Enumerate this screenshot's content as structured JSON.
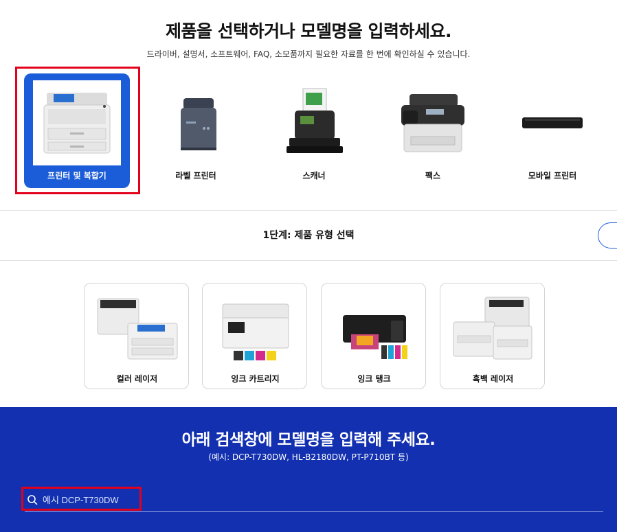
{
  "header": {
    "title": "제품을 선택하거나 모델명을 입력하세요.",
    "subtitle": "드라이버, 설명서, 소프트웨어, FAQ, 소모품까지 필요한 자료를 한 번에 확인하실 수 있습니다."
  },
  "categories": [
    {
      "label": "프린터 및 복합기",
      "icon": "laser-printer-image",
      "selected": true
    },
    {
      "label": "라벨 프린터",
      "icon": "label-printer-image",
      "selected": false
    },
    {
      "label": "스캐너",
      "icon": "scanner-image",
      "selected": false
    },
    {
      "label": "팩스",
      "icon": "fax-image",
      "selected": false
    },
    {
      "label": "모바일 프린터",
      "icon": "mobile-printer-image",
      "selected": false
    }
  ],
  "step": {
    "title": "1단계: 제품 유형 선택"
  },
  "types": [
    {
      "label": "컬러 레이저",
      "icon": "color-laser-image"
    },
    {
      "label": "잉크 카트리지",
      "icon": "ink-cartridge-printer-image"
    },
    {
      "label": "잉크 탱크",
      "icon": "ink-tank-printer-image"
    },
    {
      "label": "흑백 레이저",
      "icon": "mono-laser-image"
    }
  ],
  "search": {
    "title": "아래 검색창에 모델명을 입력해 주세요.",
    "example": "(예시: DCP-T730DW, HL-B2180DW, PT-P710BT 등)",
    "placeholder": "예시 DCP-T730DW",
    "value": ""
  },
  "colors": {
    "accent_blue": "#1b5cd8",
    "band_blue": "#1230b0",
    "highlight_red": "#e3001b"
  }
}
